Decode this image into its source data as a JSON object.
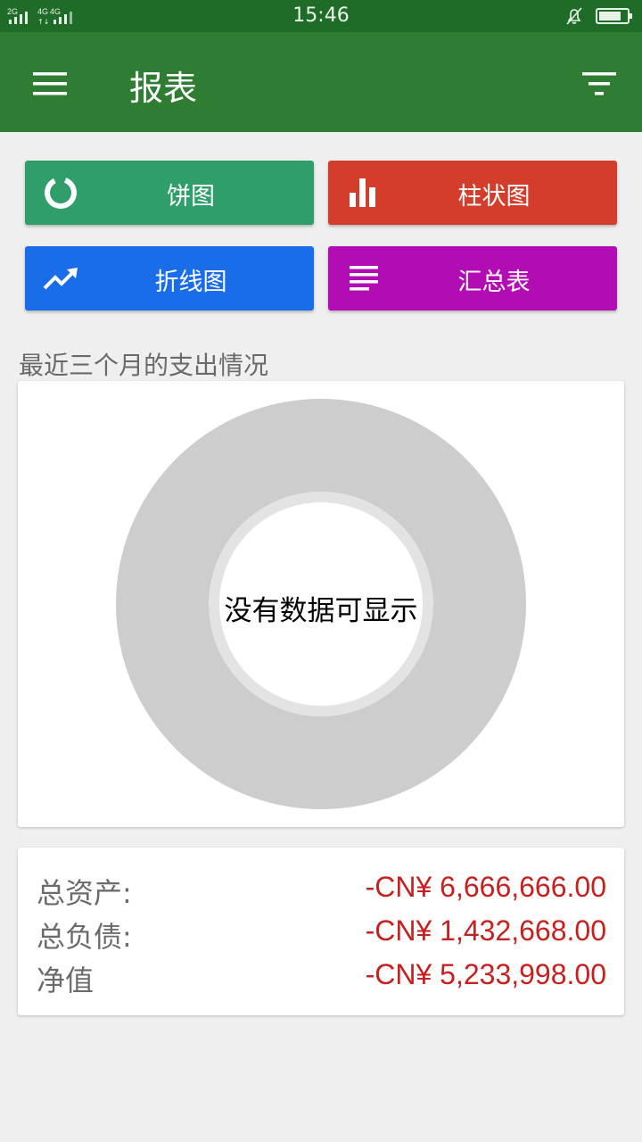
{
  "status_bar": {
    "signal_labels": [
      "2G",
      "4G",
      "4G"
    ],
    "time": "15:46",
    "icons": [
      "signal-icon",
      "bell-off-icon",
      "battery-icon"
    ]
  },
  "app_bar": {
    "title": "报表",
    "background": "#2f7d33",
    "icons": [
      "menu-icon",
      "filter-icon"
    ]
  },
  "report_buttons": {
    "pie": {
      "label": "饼图",
      "color": "#2f9e6b",
      "icon": "donut-chart-icon"
    },
    "bar": {
      "label": "柱状图",
      "color": "#d43d2c",
      "icon": "bar-chart-icon"
    },
    "line": {
      "label": "折线图",
      "color": "#1a6de8",
      "icon": "trending-up-icon"
    },
    "summary": {
      "label": "汇总表",
      "color": "#b20cb4",
      "icon": "lines-icon"
    }
  },
  "chart_section": {
    "title": "最近三个月的支出情况",
    "empty_message": "没有数据可显示"
  },
  "summary": {
    "rows": [
      {
        "label": "总资产:",
        "value": "-CN¥ 6,666,666.00"
      },
      {
        "label": "总负债:",
        "value": "-CN¥ 1,432,668.00"
      },
      {
        "label": "净值",
        "value": "-CN¥ 5,233,998.00"
      }
    ],
    "value_color": "#c62020"
  }
}
